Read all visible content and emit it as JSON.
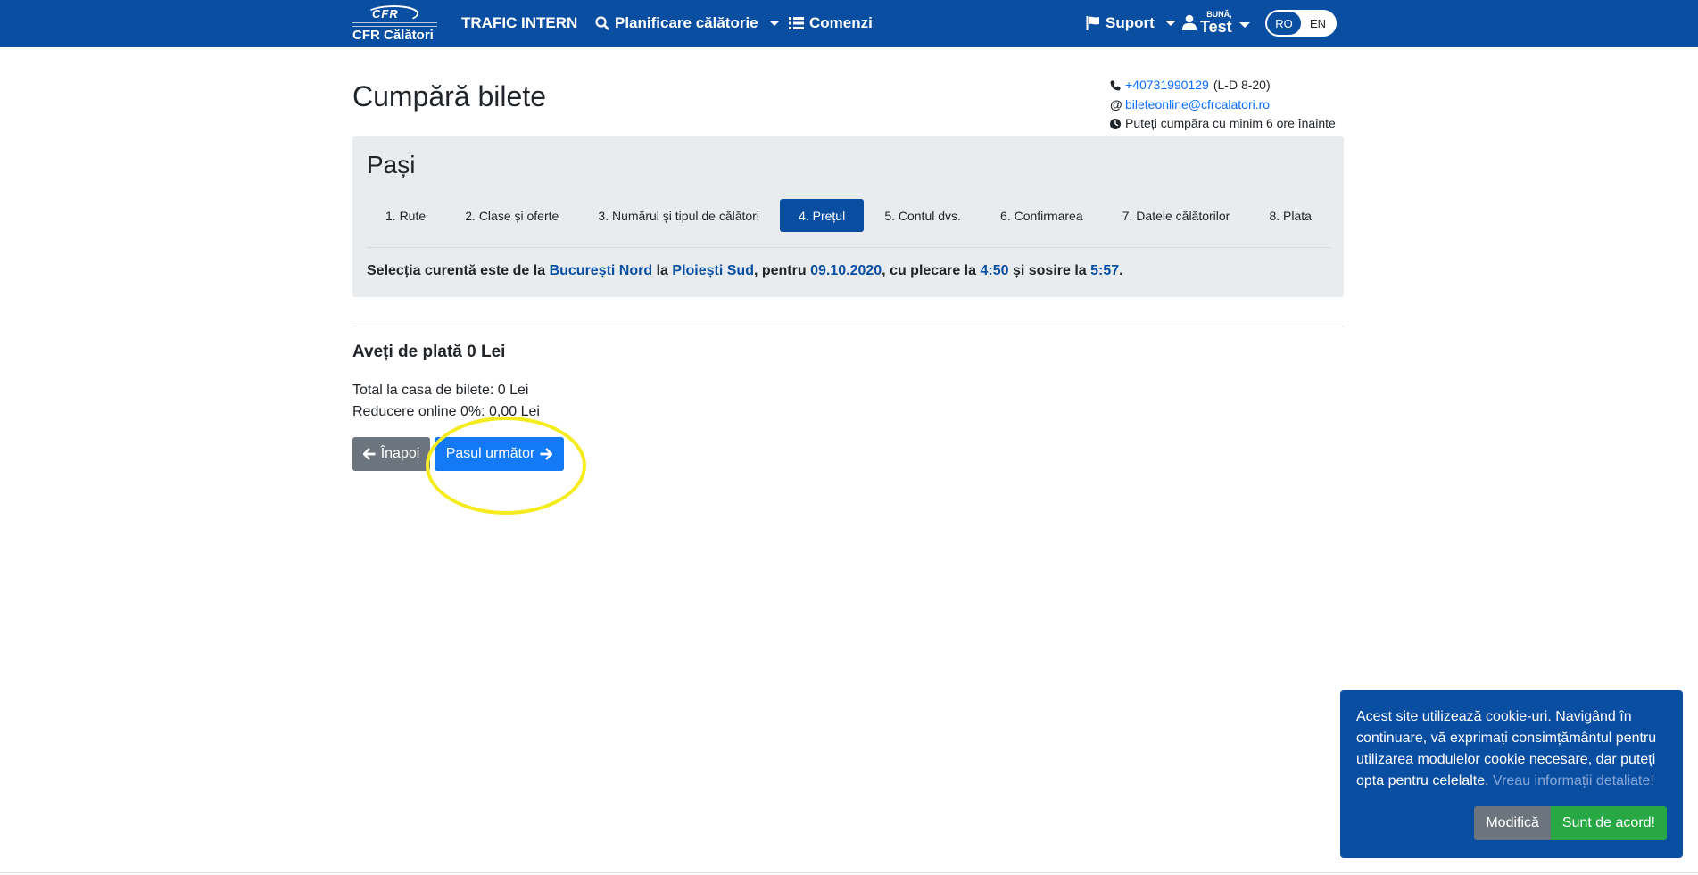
{
  "navbar": {
    "logo_small": "CFR",
    "logo_name": "CFR Călători",
    "traffic": "TRAFIC INTERN",
    "planning": "Planificare călătorie",
    "orders": "Comenzi",
    "support": "Suport",
    "user_greeting": "BUNĂ,",
    "user_name": "Test",
    "lang_ro": "RO",
    "lang_en": "EN"
  },
  "page": {
    "title": "Cumpără bilete"
  },
  "contact": {
    "phone": "+40731990129",
    "phone_hours": "(L-D 8-20)",
    "email": "bileteonline@cfrcalatori.ro",
    "notice": "Puteți cumpăra cu minim 6 ore înainte"
  },
  "steps": {
    "title": "Pași",
    "items": [
      {
        "label": "1. Rute"
      },
      {
        "label": "2. Clase și oferte"
      },
      {
        "label": "3. Numărul și tipul de călători"
      },
      {
        "label": "4. Prețul"
      },
      {
        "label": "5. Contul dvs."
      },
      {
        "label": "6. Confirmarea"
      },
      {
        "label": "7. Datele călătorilor"
      },
      {
        "label": "8. Plata"
      }
    ],
    "active_index": 3
  },
  "selection": {
    "prefix": "Selecția curentă este de la",
    "from": "București Nord",
    "to_word": "la",
    "to": "Ploiești Sud",
    "for_word": ", pentru",
    "date": "09.10.2020",
    "departure_word": ", cu plecare la",
    "departure": "4:50",
    "arrival_word": "și sosire la",
    "arrival": "5:57",
    "end": "."
  },
  "payment": {
    "title": "Aveți de plată 0 Lei",
    "total": "Total la casa de bilete: 0 Lei",
    "discount": "Reducere online 0%: 0,00 Lei"
  },
  "actions": {
    "back": "Înapoi",
    "next": "Pasul următor"
  },
  "cookie": {
    "text": "Acest site utilizează cookie-uri. Navigând în continuare, vă exprimați consimțământul pentru utilizarea modulelor cookie necesare, dar puteți opta pentru celelalte.",
    "link": "Vreau informații detaliate!",
    "modify": "Modifică",
    "accept": "Sunt de acord!"
  },
  "colors": {
    "brand": "#0a4ea2",
    "primary": "#1379f5",
    "secondary": "#6c757d",
    "success": "#28a745",
    "panel": "#e9ecef",
    "highlight": "#f5ec20"
  }
}
